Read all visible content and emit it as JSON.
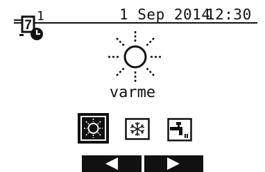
{
  "header": {
    "timer_number": "1",
    "timer_digit": "7",
    "date": "1 Sep 2014",
    "time": "12:30"
  },
  "main": {
    "mode_label": "varme"
  },
  "mode_buttons": [
    {
      "name": "heating",
      "icon": "sun-icon",
      "selected": true
    },
    {
      "name": "cooling",
      "icon": "snowflake-icon",
      "selected": false
    },
    {
      "name": "hot-water",
      "icon": "tap-icon",
      "selected": false
    }
  ],
  "nav": {
    "left_icon": "arrow-left-icon",
    "right_icon": "arrow-right-icon"
  }
}
